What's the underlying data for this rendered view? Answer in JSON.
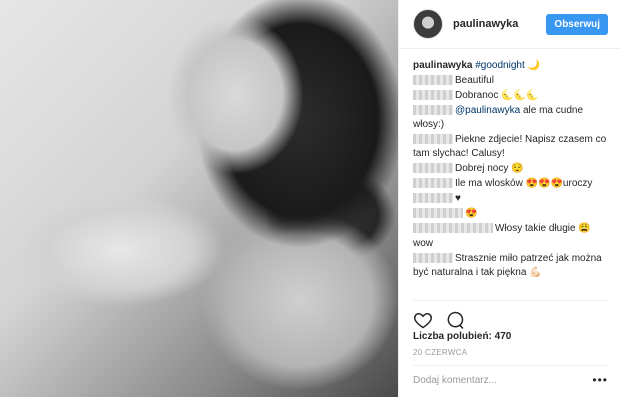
{
  "header": {
    "username": "paulinawyka",
    "follow_label": "Obserwuj"
  },
  "caption": {
    "username": "paulinawyka",
    "hashtag": "#goodnight",
    "emoji": "🌙"
  },
  "comments": [
    {
      "blur_w": 40,
      "text": "Beautiful"
    },
    {
      "blur_w": 40,
      "text": "Dobranoc 🌜🌜🌜"
    },
    {
      "blur_w": 40,
      "mention": "@paulinawyka",
      "text": " ale ma cudne włosy:)"
    },
    {
      "blur_w": 40,
      "text": "Piekne zdjecie! Napisz czasem co tam slychac! Calusy!"
    },
    {
      "blur_w": 40,
      "text": "Dobrej nocy 😌"
    },
    {
      "blur_w": 40,
      "text": "Ile ma wlosków 😍😍😍uroczy"
    },
    {
      "blur_w": 40,
      "text": "♥"
    },
    {
      "blur_w": 50,
      "text": "😍"
    },
    {
      "blur_w": 80,
      "text": "Włosy takie długie 😩"
    },
    {
      "blur_w": 0,
      "text": "wow"
    },
    {
      "blur_w": 40,
      "text": "Strasznie miło patrzeć jak można być naturalna i tak piękna 💪🏻"
    }
  ],
  "likes": {
    "label": "Liczba polubień: 470"
  },
  "date": "20 CZERWCA",
  "add_comment": {
    "placeholder": "Dodaj komentarz..."
  },
  "icons": [
    "heart-icon",
    "comment-icon",
    "more-options-icon"
  ]
}
